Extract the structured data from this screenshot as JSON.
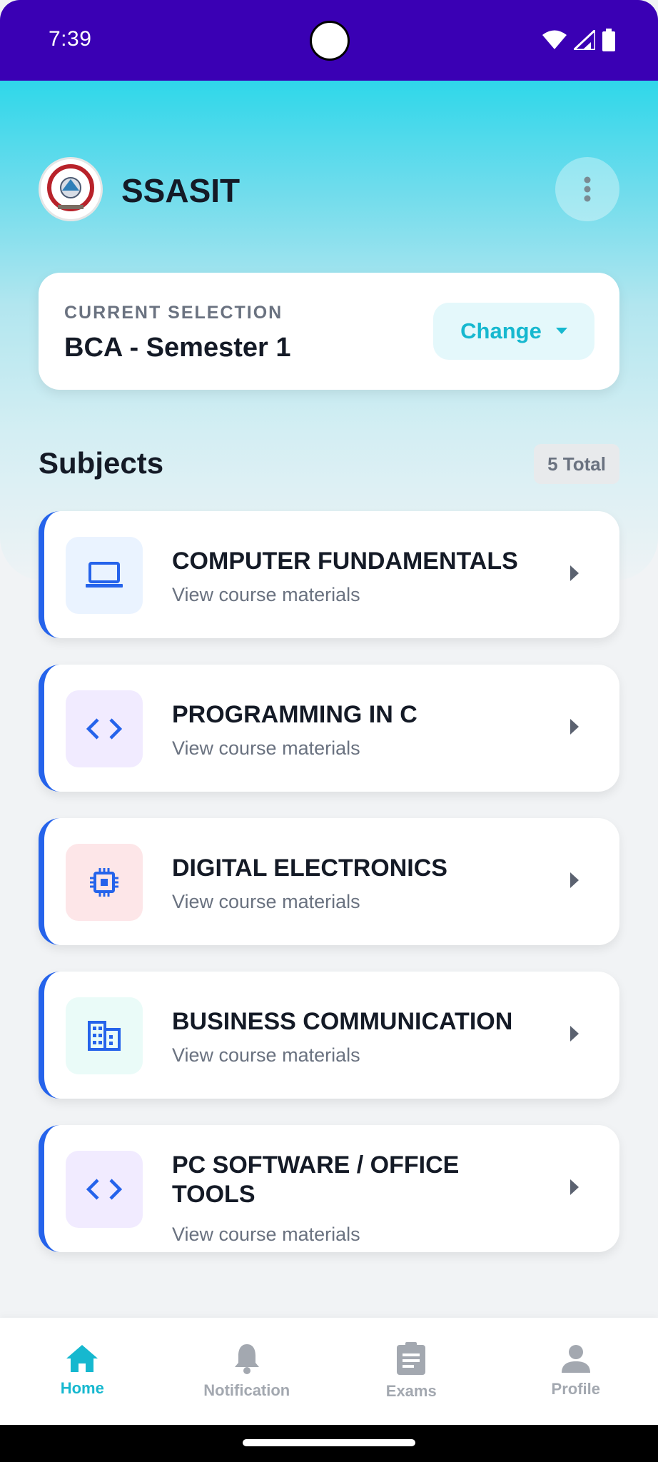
{
  "status_bar": {
    "time": "7:39",
    "icons": [
      "wifi-icon",
      "signal-icon",
      "battery-icon"
    ]
  },
  "header": {
    "app_title": "SSASIT",
    "logo": "college-logo",
    "menu_icon": "more-vert-icon"
  },
  "selection": {
    "label": "CURRENT SELECTION",
    "value": "BCA - Semester 1",
    "change_label": "Change"
  },
  "subjects": {
    "title": "Subjects",
    "total": "5 Total",
    "items": [
      {
        "name": "COMPUTER FUNDAMENTALS",
        "subtitle": "View course materials",
        "icon": "laptop-icon",
        "icon_bg": "#eaf3ff"
      },
      {
        "name": "PROGRAMMING IN C",
        "subtitle": "View course materials",
        "icon": "code-icon",
        "icon_bg": "#f1ebff"
      },
      {
        "name": "DIGITAL ELECTRONICS",
        "subtitle": "View course materials",
        "icon": "chip-icon",
        "icon_bg": "#fde6e8"
      },
      {
        "name": "BUSINESS COMMUNICATION",
        "subtitle": "View course materials",
        "icon": "building-icon",
        "icon_bg": "#eafbf8"
      },
      {
        "name": "PC SOFTWARE / OFFICE TOOLS",
        "subtitle": "View course materials",
        "icon": "code-icon",
        "icon_bg": "#f1ebff"
      }
    ]
  },
  "bottom_nav": {
    "items": [
      {
        "label": "Home",
        "icon": "home-icon",
        "active": true
      },
      {
        "label": "Notification",
        "icon": "bell-icon",
        "active": false
      },
      {
        "label": "Exams",
        "icon": "clipboard-icon",
        "active": false
      },
      {
        "label": "Profile",
        "icon": "person-icon",
        "active": false
      }
    ]
  },
  "colors": {
    "status_bar": "#3a00b4",
    "accent": "#16b8cf",
    "card_border": "#2563eb",
    "icon_blue": "#2563eb"
  }
}
